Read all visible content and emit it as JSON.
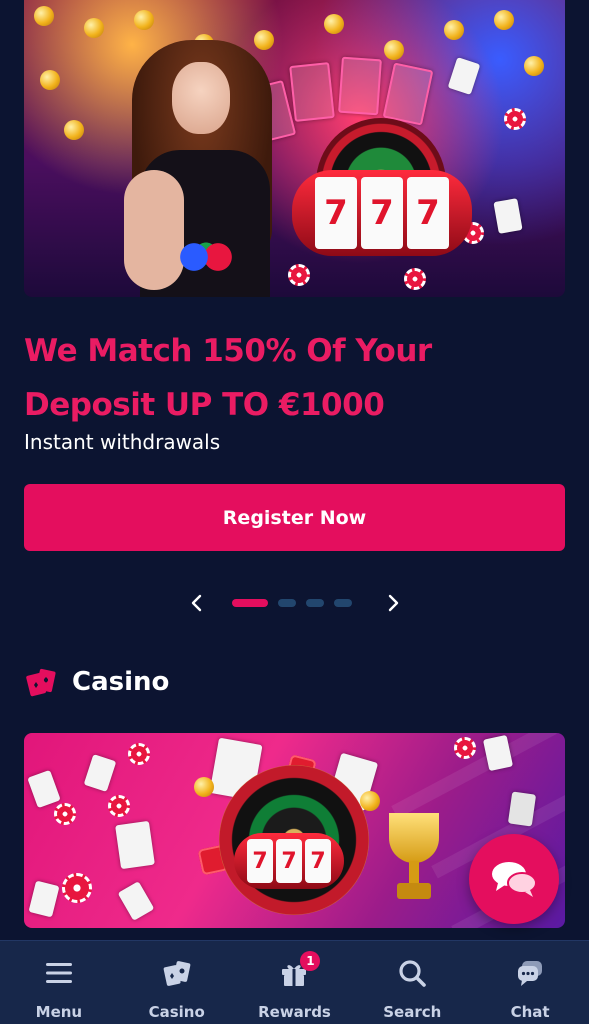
{
  "hero": {
    "title_line1": "We Match 150% Of Your",
    "title_line2": "Deposit UP TO €1000",
    "subtitle": "Instant withdrawals",
    "cta_label": "Register Now",
    "reel_symbol": "7"
  },
  "carousel": {
    "slide_count": 4,
    "active_index": 0
  },
  "casino_section": {
    "title": "Casino"
  },
  "colors": {
    "accent": "#e40e5e",
    "headline": "#ea1c63",
    "background": "#0c1431",
    "nav_background": "#17274a",
    "dot_inactive": "#22466e"
  },
  "bottom_nav": {
    "items": [
      {
        "label": "Menu",
        "icon": "menu-icon"
      },
      {
        "label": "Casino",
        "icon": "cards-icon"
      },
      {
        "label": "Rewards",
        "icon": "gift-icon",
        "badge": "1"
      },
      {
        "label": "Search",
        "icon": "search-icon"
      },
      {
        "label": "Chat",
        "icon": "chat-icon"
      }
    ]
  },
  "chat_fab": {
    "icon": "chat-bubbles-icon"
  }
}
